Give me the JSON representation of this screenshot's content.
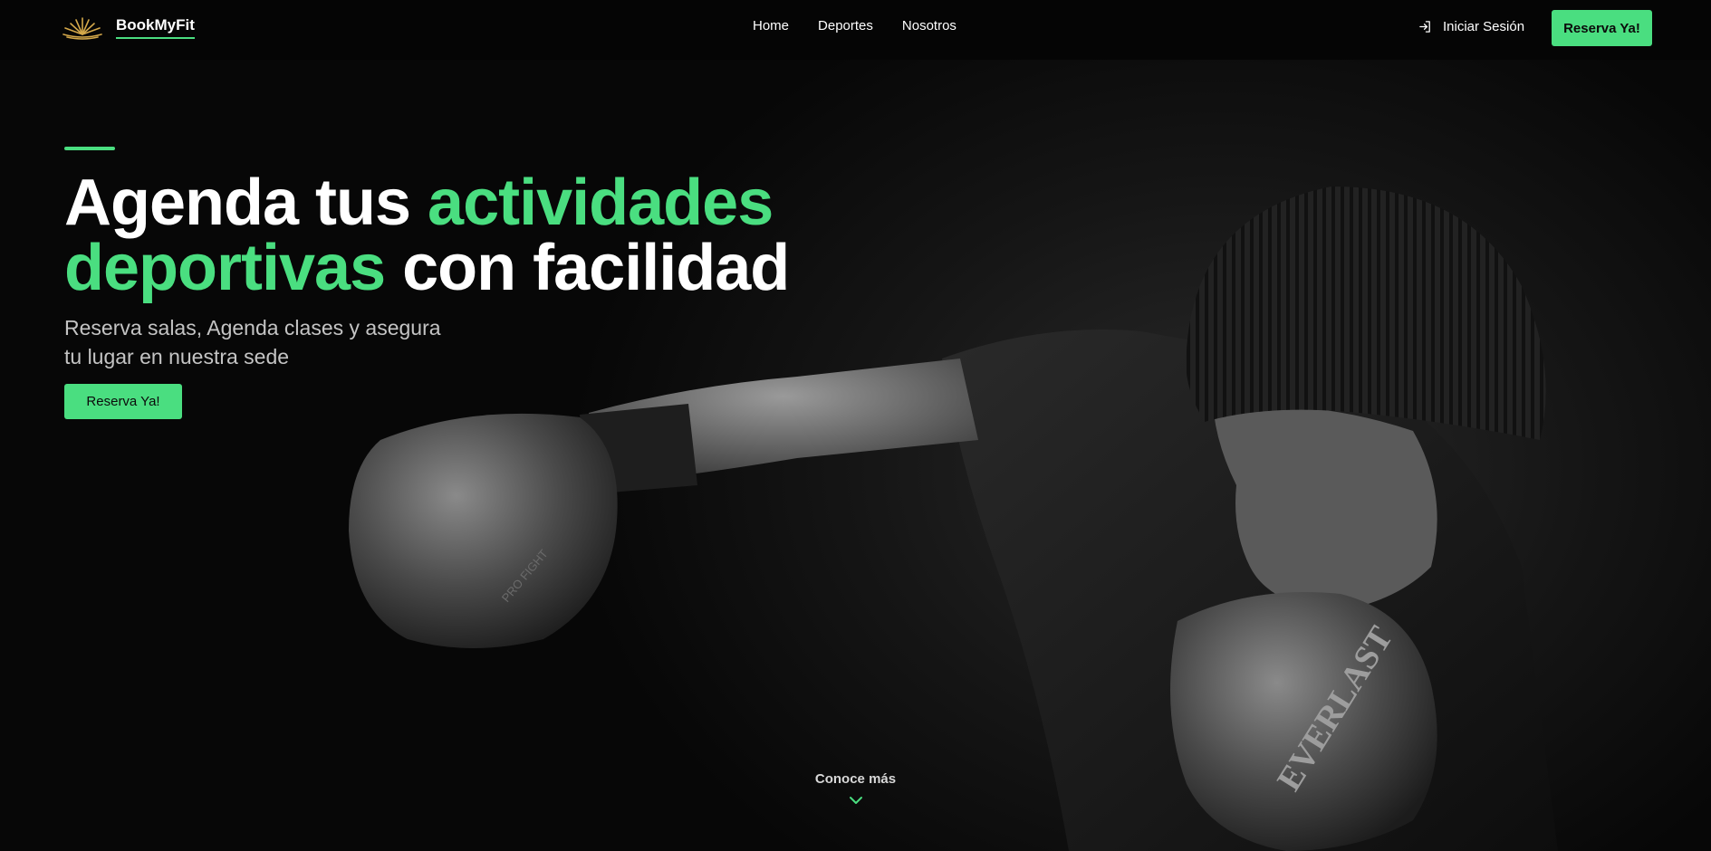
{
  "brand": {
    "name": "BookMyFit",
    "logo_icon": "lotus-logo-icon"
  },
  "nav": {
    "links": [
      {
        "label": "Home"
      },
      {
        "label": "Deportes"
      },
      {
        "label": "Nosotros"
      }
    ],
    "login_label": "Iniciar Sesión",
    "login_icon": "sign-in-icon",
    "cta_label": "Reserva Ya!"
  },
  "hero": {
    "headline_line1_white": "Agenda tus ",
    "headline_line1_green": "actividades",
    "headline_line2_green": "deportivas",
    "headline_line2_white": " con facilidad",
    "subtitle": "Reserva salas, Agenda clases y asegura tu lugar en nuestra sede",
    "cta_label": "Reserva Ya!",
    "image_subject": "boxer-photo",
    "glove_brand_left": "PRO FIGHT",
    "glove_brand_right": "EVERLAST"
  },
  "scroll_hint": {
    "label": "Conoce más",
    "icon": "chevron-down-icon"
  },
  "colors": {
    "accent": "#4ade80",
    "background": "#000000",
    "text": "#ffffff",
    "muted": "#c4c4c4"
  }
}
